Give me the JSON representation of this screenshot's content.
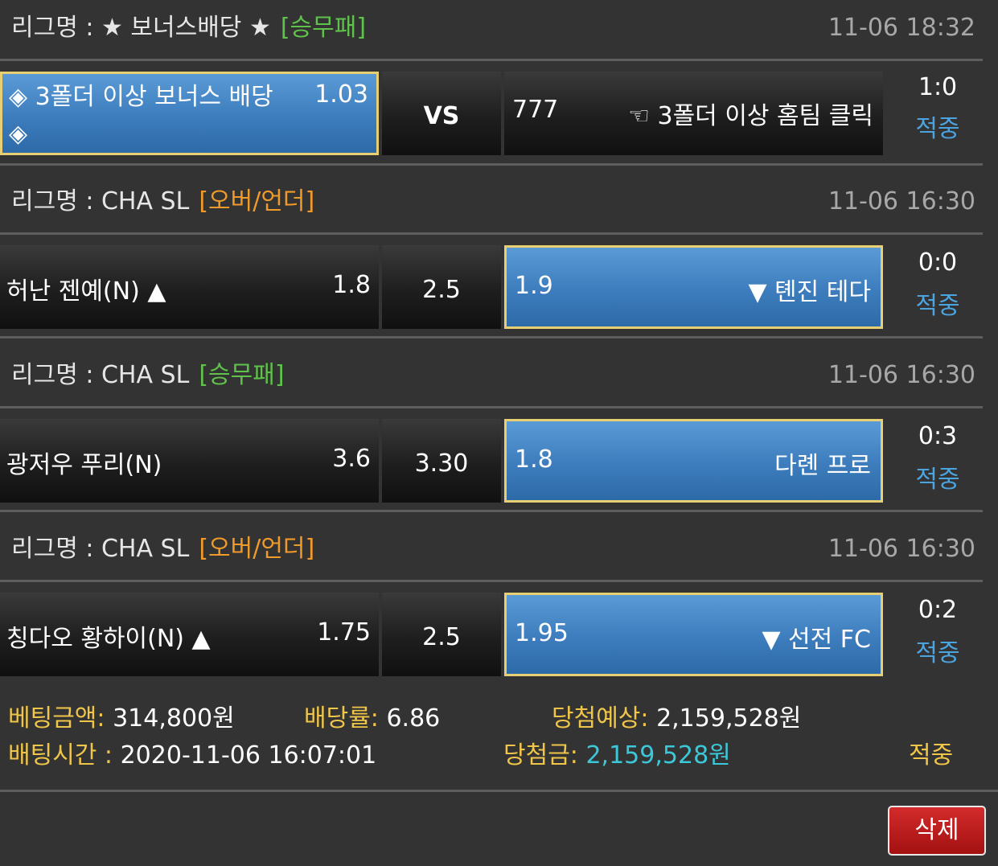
{
  "colors": {
    "background": "#333333",
    "selected_blue": "#3f7fbf",
    "selected_border": "#e8cf73",
    "type_win_draw_lose": "#5fc24a",
    "type_over_under": "#f09a2a",
    "status_blue": "#4ba3e0",
    "label_yellow": "#f0c64a",
    "win_amount_cyan": "#3cc8d8",
    "delete_red": "#c21e1e"
  },
  "games": [
    {
      "league_label": "리그명 : ★ 보너스배당 ★",
      "bet_type": "[승무패]",
      "bet_type_color": "#5fc24a",
      "time": "11-06 18:32",
      "home_team": "◈ 3폴더 이상 보너스 배당 ◈",
      "home_odd": "1.03",
      "middle": "VS",
      "away_odd": "777",
      "away_team": "☜ 3폴더 이상 홈팀 클릭",
      "score": "1:0",
      "status": "적중"
    },
    {
      "league_label": "리그명 : CHA SL",
      "bet_type": "[오버/언더]",
      "bet_type_color": "#f09a2a",
      "time": "11-06 16:30",
      "home_team": "허난 젠예(N) ▲",
      "home_odd": "1.8",
      "middle": "2.5",
      "away_odd": "1.9",
      "away_team": "▼ 톈진 테다",
      "score": "0:0",
      "status": "적중"
    },
    {
      "league_label": "리그명 : CHA SL",
      "bet_type": "[승무패]",
      "bet_type_color": "#5fc24a",
      "time": "11-06 16:30",
      "home_team": "광저우 푸리(N)",
      "home_odd": "3.6",
      "middle": "3.30",
      "away_odd": "1.8",
      "away_team": "다롄 프로",
      "score": "0:3",
      "status": "적중"
    },
    {
      "league_label": "리그명 : CHA SL",
      "bet_type": "[오버/언더]",
      "bet_type_color": "#f09a2a",
      "time": "11-06 16:30",
      "home_team": "칭다오 황하이(N) ▲",
      "home_odd": "1.75",
      "middle": "2.5",
      "away_odd": "1.95",
      "away_team": "▼ 선전 FC",
      "score": "0:2",
      "status": "적중"
    }
  ],
  "summary": {
    "bet_amount_label": "베팅금액:",
    "bet_amount": "314,800원",
    "odds_label": "배당률:",
    "odds": "6.86",
    "expected_label": "당첨예상:",
    "expected": "2,159,528원",
    "bet_time_label": "배팅시간 :",
    "bet_time": "2020-11-06 16:07:01",
    "win_label": "당첨금:",
    "win_amount": "2,159,528원",
    "result": "적중"
  },
  "delete_button": "삭제"
}
